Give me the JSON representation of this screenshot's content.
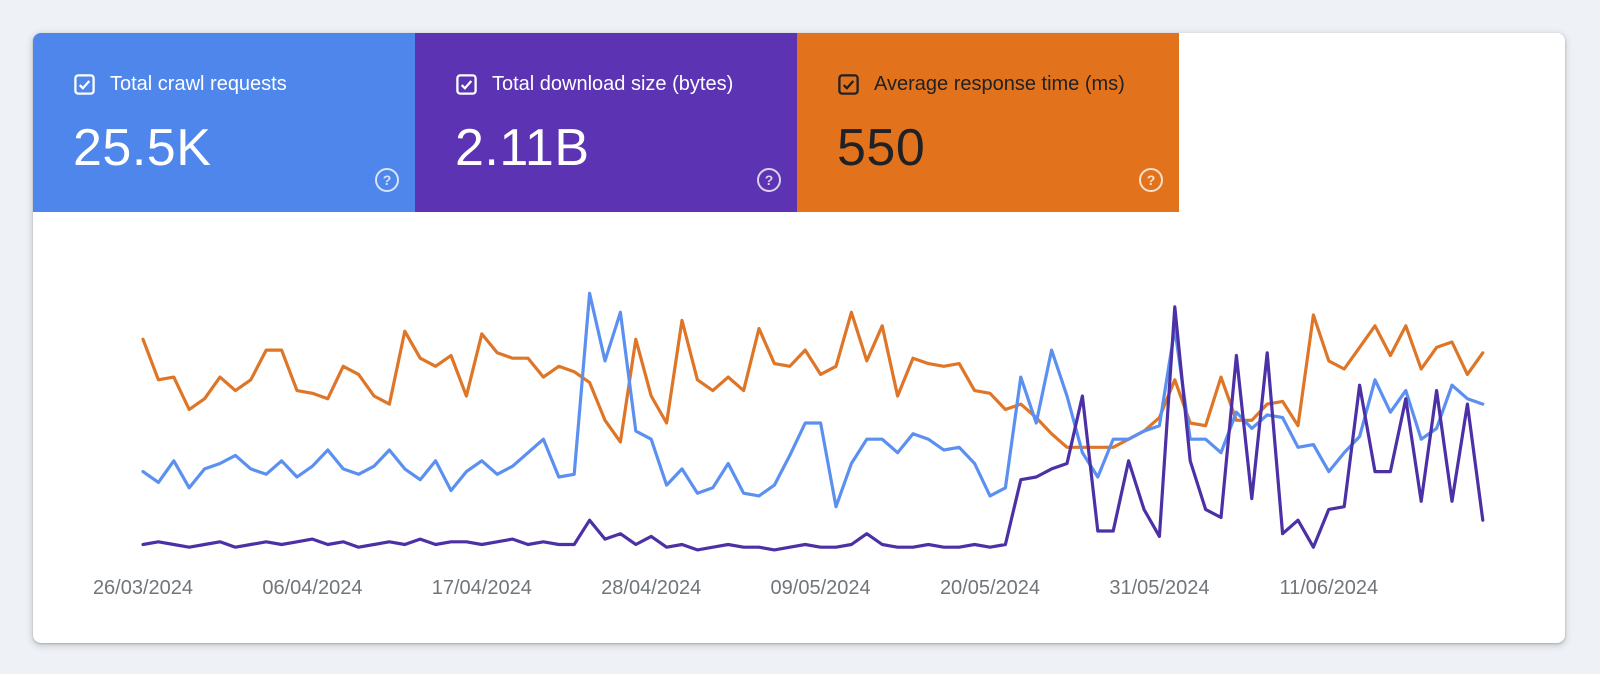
{
  "cards": [
    {
      "label": "Total crawl requests",
      "value": "25.5K",
      "checked": true,
      "color": "#4e86ec",
      "text_color": "#ffffff",
      "help_color": "#ffffff",
      "help_icon": "?"
    },
    {
      "label": "Total download size (bytes)",
      "value": "2.11B",
      "checked": true,
      "color": "#5b33b3",
      "text_color": "#ffffff",
      "help_color": "#ffffff",
      "help_icon": "?"
    },
    {
      "label": "Average response time (ms)",
      "value": "550",
      "checked": true,
      "color": "#e2731c",
      "text_color": "#202124",
      "help_color": "#ffffff",
      "help_icon": "?"
    }
  ],
  "chart_data": {
    "type": "line",
    "title": "",
    "xlabel": "",
    "ylabel": "",
    "x_unit": "day",
    "points_per_series": 88,
    "grid": false,
    "legend_position": "stat-cards-above",
    "y_axis": {
      "visible": false,
      "scale": "relative height 0-100 of plot area (no axis labels shown)"
    },
    "x_ticks": [
      {
        "day": 0,
        "label": "26/03/2024"
      },
      {
        "day": 11,
        "label": "06/04/2024"
      },
      {
        "day": 22,
        "label": "17/04/2024"
      },
      {
        "day": 33,
        "label": "28/04/2024"
      },
      {
        "day": 44,
        "label": "09/05/2024"
      },
      {
        "day": 55,
        "label": "20/05/2024"
      },
      {
        "day": 66,
        "label": "31/05/2024"
      },
      {
        "day": 77,
        "label": "11/06/2024"
      }
    ],
    "series": [
      {
        "id": "average-response-time",
        "name": "Average response time (ms)",
        "color": "#de7527",
        "values": [
          81,
          66,
          67,
          55,
          59,
          67,
          62,
          66,
          77,
          77,
          62,
          61,
          59,
          71,
          68,
          60,
          57,
          84,
          74,
          71,
          75,
          60,
          83,
          76,
          74,
          74,
          67,
          71,
          69,
          65,
          51,
          43,
          81,
          60,
          50,
          88,
          66,
          62,
          67,
          62,
          85,
          72,
          71,
          77,
          68,
          71,
          91,
          73,
          86,
          60,
          74,
          72,
          71,
          72,
          62,
          61,
          55,
          57,
          52,
          46,
          41,
          41,
          41,
          41,
          44,
          47,
          52,
          66,
          50,
          49,
          67,
          51,
          51,
          57,
          58,
          49,
          90,
          73,
          70,
          78,
          86,
          75,
          86,
          70,
          78,
          80,
          68,
          76
        ]
      },
      {
        "id": "total-crawl-requests",
        "name": "Total crawl requests",
        "color": "#5c90f0",
        "values": [
          32,
          28,
          36,
          26,
          33,
          35,
          38,
          33,
          31,
          36,
          30,
          34,
          40,
          33,
          31,
          34,
          40,
          33,
          29,
          36,
          25,
          32,
          36,
          31,
          34,
          39,
          44,
          30,
          31,
          98,
          73,
          91,
          47,
          44,
          27,
          33,
          24,
          26,
          35,
          24,
          23,
          27,
          38,
          50,
          50,
          19,
          35,
          44,
          44,
          39,
          46,
          44,
          40,
          41,
          35,
          23,
          26,
          67,
          50,
          77,
          60,
          39,
          30,
          44,
          44,
          47,
          49,
          85,
          44,
          44,
          39,
          54,
          48,
          53,
          52,
          41,
          42,
          32,
          39,
          45,
          66,
          54,
          62,
          44,
          48,
          64,
          59,
          57
        ]
      },
      {
        "id": "total-download-size",
        "name": "Total download size (bytes)",
        "color": "#4c30a6",
        "values": [
          5,
          6,
          5,
          4,
          5,
          6,
          4,
          5,
          6,
          5,
          6,
          7,
          5,
          6,
          4,
          5,
          6,
          5,
          7,
          5,
          6,
          6,
          5,
          6,
          7,
          5,
          6,
          5,
          5,
          14,
          7,
          9,
          5,
          8,
          4,
          5,
          3,
          4,
          5,
          4,
          4,
          3,
          4,
          5,
          4,
          4,
          5,
          9,
          5,
          4,
          4,
          5,
          4,
          4,
          5,
          4,
          5,
          29,
          30,
          33,
          35,
          60,
          10,
          10,
          36,
          18,
          8,
          93,
          36,
          18,
          15,
          75,
          22,
          76,
          9,
          14,
          4,
          18,
          19,
          64,
          32,
          32,
          59,
          21,
          62,
          21,
          57,
          14
        ]
      }
    ]
  }
}
